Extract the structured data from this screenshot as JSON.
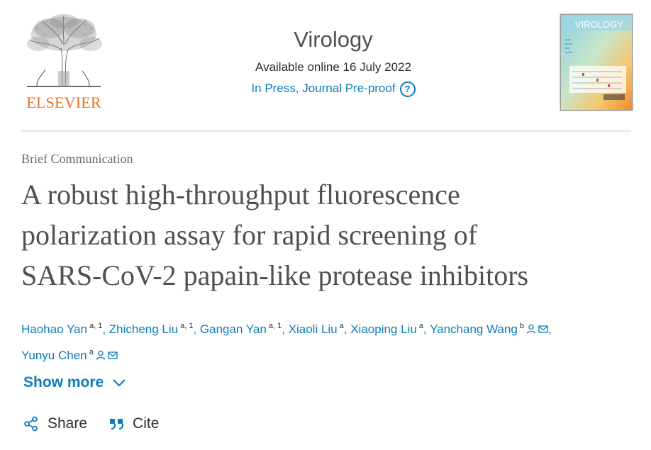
{
  "publisher": {
    "name": "ELSEVIER",
    "logo_icon": "elsevier-tree-icon",
    "accent_color": "#e9711c"
  },
  "journal": {
    "title": "Virology",
    "available_online": "Available online 16 July 2022",
    "status_link": "In Press, Journal Pre-proof",
    "help_icon": "question-circle-icon",
    "cover_title": "VIROLOGY"
  },
  "article": {
    "type": "Brief Communication",
    "title_lines": [
      "A robust high-throughput fluorescence",
      "polarization assay for rapid screening of",
      "SARS-CoV-2 papain-like protease inhibitors"
    ]
  },
  "authors": [
    {
      "name": "Haohao Yan",
      "sup": "a, 1",
      "icons": []
    },
    {
      "name": "Zhicheng Liu",
      "sup": "a, 1",
      "icons": []
    },
    {
      "name": "Gangan Yan",
      "sup": "a, 1",
      "icons": []
    },
    {
      "name": "Xiaoli Liu",
      "sup": "a",
      "icons": []
    },
    {
      "name": "Xiaoping Liu",
      "sup": "a",
      "icons": []
    },
    {
      "name": "Yanchang Wang",
      "sup": "b",
      "icons": [
        "person-icon",
        "envelope-icon"
      ]
    },
    {
      "name": "Yunyu Chen",
      "sup": "a",
      "icons": [
        "person-icon",
        "envelope-icon"
      ]
    }
  ],
  "show_more": {
    "label": "Show more",
    "icon": "chevron-down-icon"
  },
  "actions": {
    "share": {
      "label": "Share",
      "icon": "share-icon"
    },
    "cite": {
      "label": "Cite",
      "icon": "quote-icon"
    }
  },
  "colors": {
    "link": "#0c7dbb",
    "text": "#2e2e2e",
    "title": "#505050"
  }
}
